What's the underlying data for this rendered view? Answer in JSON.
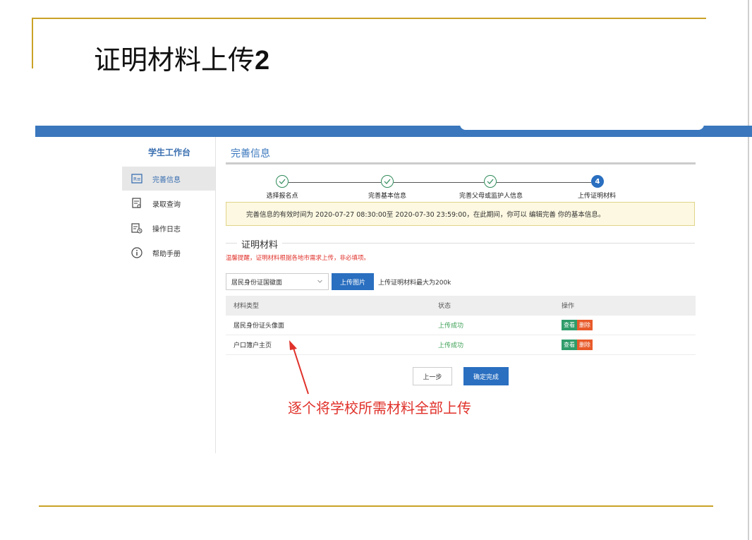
{
  "slide": {
    "title_text": "证明材料上传",
    "title_number": "2",
    "annotation": "逐个将学校所需材料全部上传"
  },
  "sidebar": {
    "title": "学生工作台",
    "items": [
      {
        "label": "完善信息",
        "icon": "id-card-icon"
      },
      {
        "label": "录取查询",
        "icon": "document-search-icon"
      },
      {
        "label": "操作日志",
        "icon": "log-clock-icon"
      },
      {
        "label": "帮助手册",
        "icon": "info-circle-icon"
      }
    ]
  },
  "main": {
    "page_title": "完善信息",
    "steps": [
      {
        "label": "选择报名点",
        "state": "done"
      },
      {
        "label": "完善基本信息",
        "state": "done"
      },
      {
        "label": "完善父母或监护人信息",
        "state": "done"
      },
      {
        "label": "上传证明材料",
        "state": "current",
        "number": "4"
      }
    ],
    "notice": "完善信息的有效时间为 2020-07-27 08:30:00至 2020-07-30 23:59:00，在此期间，你可以 编辑完善 你的基本信息。",
    "section_title": "证明材料",
    "tip": "温馨提醒，证明材料根据各地市需求上传，非必填项。",
    "select_value": "居民身份证国徽面",
    "upload_button": "上传图片",
    "upload_hint": "上传证明材料最大为200k",
    "table": {
      "headers": [
        "材料类型",
        "状态",
        "操作"
      ],
      "rows": [
        {
          "type": "居民身份证头像面",
          "status": "上传成功",
          "view": "查看",
          "delete": "删除"
        },
        {
          "type": "户口簿户主页",
          "status": "上传成功",
          "view": "查看",
          "delete": "删除"
        }
      ]
    },
    "prev_button": "上一步",
    "confirm_button": "确定完成"
  },
  "colors": {
    "accent": "#2a6fc0",
    "gold_rule": "#c9a227",
    "success": "#3da055",
    "danger": "#e0312a"
  }
}
